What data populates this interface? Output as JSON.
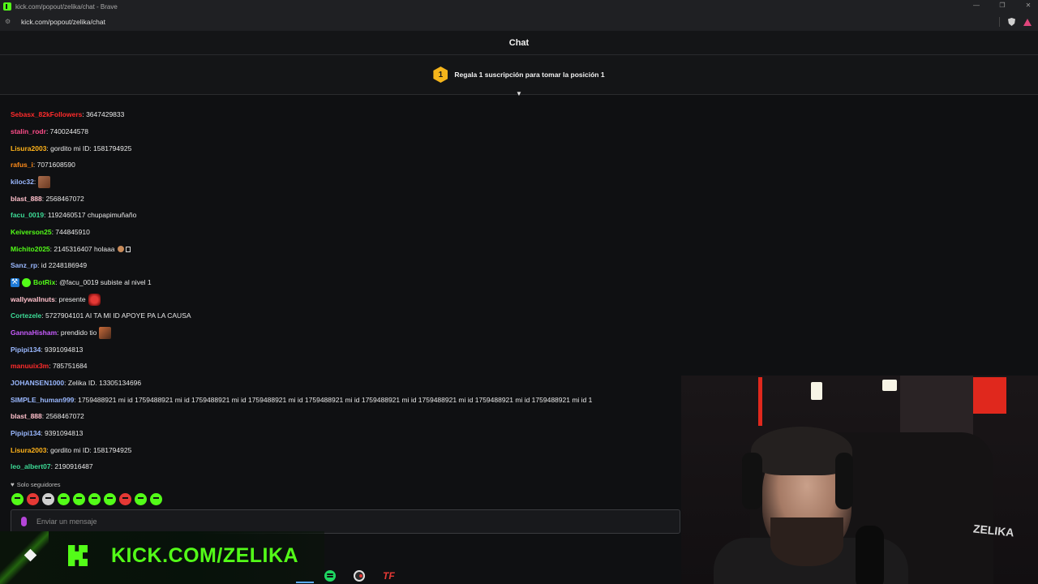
{
  "window": {
    "title": "kick.com/popout/zelika/chat - Brave",
    "url": "kick.com/popout/zelika/chat",
    "controls": [
      "—",
      "❐",
      "✕"
    ]
  },
  "chat": {
    "header": "Chat",
    "gift_banner": {
      "badge": "1",
      "text": "Regala 1 suscripción para tomar la posición 1"
    },
    "messages": [
      {
        "user": "Sebasx_82kFollowers",
        "color": "#ff2b2b",
        "text": ": 3647429833"
      },
      {
        "user": "stalin_rodr",
        "color": "#ff4d8a",
        "text": ": 7400244578"
      },
      {
        "user": "Lisura2003",
        "color": "#ffb31a",
        "text": ": gordito mi ID: 1581794925"
      },
      {
        "user": "rafus_i",
        "color": "#ff8c1a",
        "text": ": 7071608590"
      },
      {
        "user": "kiloc32",
        "color": "#9ab8ff",
        "text": ":",
        "emote": "face-emote"
      },
      {
        "user": "blast_888",
        "color": "#ffc0cb",
        "text": ": 2568467072"
      },
      {
        "user": "facu_0019",
        "color": "#3ddc97",
        "text": ": 1192460517 chupapimuñaño"
      },
      {
        "user": "Keiverson25",
        "color": "#53fc18",
        "text": ": 744845910"
      },
      {
        "user": "Michito2025",
        "color": "#53fc18",
        "text": ": 2145316407 holaaa"
      },
      {
        "user": "Sanz_rp",
        "color": "#9ab8ff",
        "text": ": id 2248186949"
      },
      {
        "user": "BotRix",
        "color": "#53fc18",
        "text": ": @facu_0019 subiste al nivel 1"
      },
      {
        "user": "wallywallnuts",
        "color": "#ffc0cb",
        "text": ": presente",
        "emote": "angry-emote"
      },
      {
        "user": "Cortezele",
        "color": "#3ddc97",
        "text": ": 5727904101 AI TA MI ID APOYE PA LA CAUSA"
      },
      {
        "user": "GannaHisham",
        "color": "#c85cff",
        "text": ": prendido tio",
        "emote": "meme-emote"
      },
      {
        "user": "Pipipi134",
        "color": "#9ab8ff",
        "text": ": 9391094813"
      },
      {
        "user": "manuuix3m",
        "color": "#ff2b2b",
        "text": ": 785751684"
      },
      {
        "user": "JOHANSEN1000",
        "color": "#9ab8ff",
        "text": ": Zelika ID. 13305134696"
      },
      {
        "user": "SIMPLE_human999",
        "color": "#9ab8ff",
        "text": ": 1759488921 mi id 1759488921 mi id 1759488921 mi id 1759488921 mi id 1759488921 mi id 1759488921 mi id 1759488921 mi id 1759488921 mi id 1759488921 mi id 1"
      },
      {
        "user": "blast_888",
        "color": "#ffc0cb",
        "text": ": 2568467072"
      },
      {
        "user": "Pipipi134",
        "color": "#9ab8ff",
        "text": ": 9391094813"
      },
      {
        "user": "Lisura2003",
        "color": "#ffb31a",
        "text": ": gordito mi ID: 1581794925"
      },
      {
        "user": "leo_albert07",
        "color": "#3ddc97",
        "text": ": 2190916487"
      }
    ],
    "followers_only": "Solo seguidores",
    "input_placeholder": "Enviar un mensaje"
  },
  "overlay": {
    "kick_url": "KICK.COM/ZELIKA",
    "webcam_sign": "ZELIKA"
  },
  "colors": {
    "brand": "#53fc18",
    "background": "#0f1012",
    "gift_badge": "#f5b51b"
  }
}
